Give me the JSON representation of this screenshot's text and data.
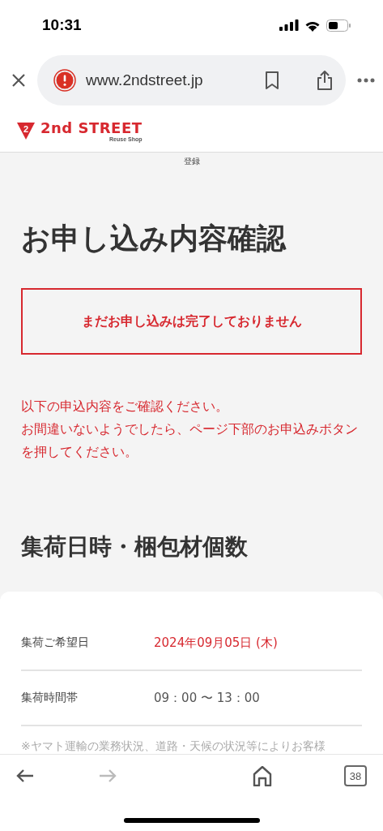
{
  "status_bar": {
    "time": "10:31"
  },
  "browser": {
    "url": "www.2ndstreet.jp",
    "tab_count": "38"
  },
  "site_header": {
    "logo_mark": "2",
    "logo_text": "2nd STREET",
    "logo_sub": "Reuse Shop"
  },
  "breadcrumb": "登録",
  "page_title": "お申し込み内容確認",
  "warning": "まだお申し込みは完了しておりません",
  "notice": [
    "以下の申込内容をご確認ください。",
    "お間違いないようでしたら、ページ下部のお申込みボタンを押してください。"
  ],
  "section_title": "集荷日時・梱包材個数",
  "details": [
    {
      "label": "集荷ご希望日",
      "value": "2024年09月05日 (木)",
      "highlight": true
    },
    {
      "label": "集荷時間帯",
      "value": "09：00 〜 13：00",
      "highlight": false
    }
  ],
  "note": "※ヤマト運輸の業務状況、道路・天候の状況等によりお客様",
  "toolbar": {
    "forward_disabled": true
  }
}
